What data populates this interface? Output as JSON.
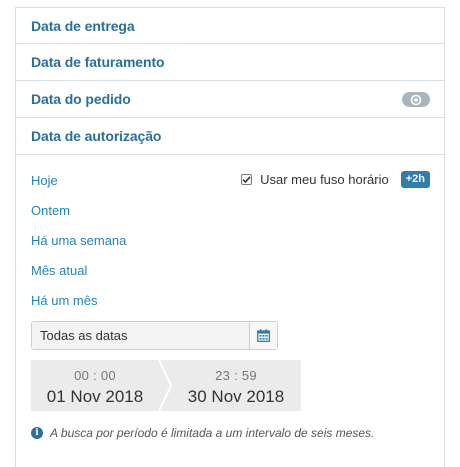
{
  "accordion": {
    "items": [
      {
        "label": "Data de entrega"
      },
      {
        "label": "Data de faturamento"
      },
      {
        "label": "Data do pedido",
        "badge_icon": "eye-icon"
      },
      {
        "label": "Data de autorização"
      }
    ]
  },
  "quick_links": [
    "Hoje",
    "Ontem",
    "Há uma semana",
    "Mês atual",
    "Há um mês"
  ],
  "timezone": {
    "checked": true,
    "label": "Usar meu fuso horário",
    "offset_badge": "+2h"
  },
  "date_select": {
    "value": "Todas as datas",
    "icon": "calendar-icon"
  },
  "range": {
    "start_time": "00 : 00",
    "start_date": "01 Nov 2018",
    "end_time": "23 : 59",
    "end_date": "30 Nov 2018"
  },
  "note": {
    "icon": "info-icon",
    "text": "A busca por período é limitada a um intervalo de seis meses."
  },
  "colors": {
    "link": "#2384b7",
    "title": "#2a6f97",
    "badge": "#2e7fad",
    "border": "#d7dfe5"
  }
}
